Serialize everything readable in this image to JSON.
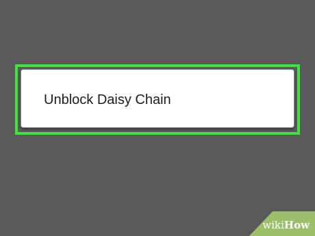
{
  "menu": {
    "item_label": "Unblock Daisy Chain"
  },
  "highlight": {
    "color": "#39e639"
  },
  "watermark": {
    "prefix": "wiki",
    "suffix": "How",
    "color": "#9bbf6a"
  },
  "colors": {
    "background": "#5a5a5a",
    "card": "#ffffff"
  }
}
